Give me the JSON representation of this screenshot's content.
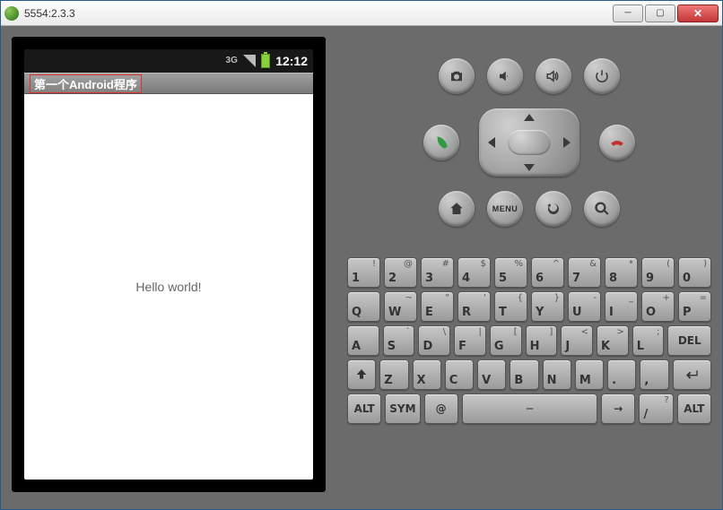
{
  "window": {
    "title": "5554:2.3.3"
  },
  "statusbar": {
    "time": "12:12"
  },
  "app": {
    "title": "第一个Android程序",
    "body_text": "Hello world!"
  },
  "hw": {
    "menu_label": "MENU"
  },
  "keyboard": {
    "row1": [
      {
        "m": "1",
        "a": "!"
      },
      {
        "m": "2",
        "a": "@"
      },
      {
        "m": "3",
        "a": "#"
      },
      {
        "m": "4",
        "a": "$"
      },
      {
        "m": "5",
        "a": "%"
      },
      {
        "m": "6",
        "a": "^"
      },
      {
        "m": "7",
        "a": "&"
      },
      {
        "m": "8",
        "a": "*"
      },
      {
        "m": "9",
        "a": "("
      },
      {
        "m": "0",
        "a": ")"
      }
    ],
    "row2": [
      {
        "m": "Q",
        "a": ""
      },
      {
        "m": "W",
        "a": "~"
      },
      {
        "m": "E",
        "a": "\""
      },
      {
        "m": "R",
        "a": "'"
      },
      {
        "m": "T",
        "a": "{"
      },
      {
        "m": "Y",
        "a": "}"
      },
      {
        "m": "U",
        "a": "-"
      },
      {
        "m": "I",
        "a": "_"
      },
      {
        "m": "O",
        "a": "+"
      },
      {
        "m": "P",
        "a": "="
      }
    ],
    "row3": [
      {
        "m": "A",
        "a": ""
      },
      {
        "m": "S",
        "a": "`"
      },
      {
        "m": "D",
        "a": "\\"
      },
      {
        "m": "F",
        "a": "|"
      },
      {
        "m": "G",
        "a": "["
      },
      {
        "m": "H",
        "a": "]"
      },
      {
        "m": "J",
        "a": "<"
      },
      {
        "m": "K",
        "a": ">"
      },
      {
        "m": "L",
        "a": ";"
      }
    ],
    "row3_del": {
      "m": "DEL",
      "a": ""
    },
    "row4": [
      {
        "m": "Z",
        "a": ""
      },
      {
        "m": "X",
        "a": ""
      },
      {
        "m": "C",
        "a": ""
      },
      {
        "m": "V",
        "a": ""
      },
      {
        "m": "B",
        "a": ""
      },
      {
        "m": "N",
        "a": ""
      },
      {
        "m": "M",
        "a": ""
      },
      {
        "m": ".",
        "a": ""
      },
      {
        "m": ",",
        "a": ""
      }
    ],
    "row5": {
      "alt": "ALT",
      "sym": "SYM",
      "at": "@",
      "slash": "/",
      "question": "?",
      "alt2": "ALT"
    }
  }
}
